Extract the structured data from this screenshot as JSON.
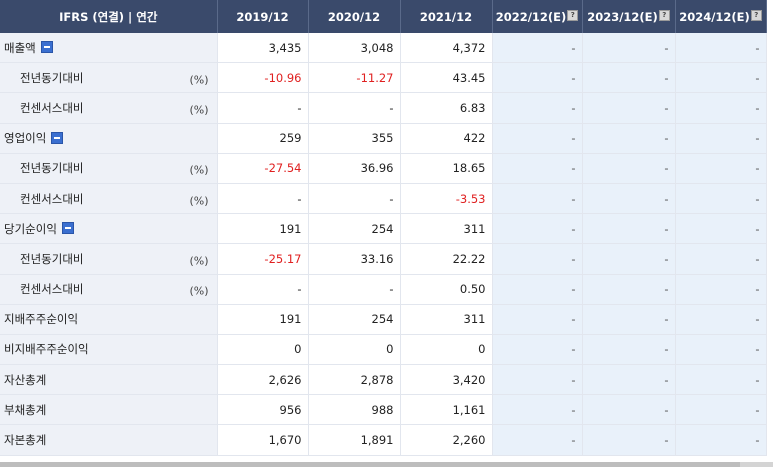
{
  "header": {
    "label": "IFRS (연결) | 연간",
    "columns": [
      {
        "label": "2019/12",
        "estimate": false
      },
      {
        "label": "2020/12",
        "estimate": false
      },
      {
        "label": "2021/12",
        "estimate": false
      },
      {
        "label": "2022/12(E)",
        "estimate": true
      },
      {
        "label": "2023/12(E)",
        "estimate": true
      },
      {
        "label": "2024/12(E)",
        "estimate": true
      }
    ],
    "estimate_icon": "?"
  },
  "rows": [
    {
      "label": "매출액",
      "unit": "",
      "expandable": true,
      "sub": false,
      "values": [
        "3,435",
        "3,048",
        "4,372",
        "-",
        "-",
        "-"
      ]
    },
    {
      "label": "전년동기대비",
      "unit": "(%)",
      "expandable": false,
      "sub": true,
      "values": [
        "-10.96",
        "-11.27",
        "43.45",
        "-",
        "-",
        "-"
      ]
    },
    {
      "label": "컨센서스대비",
      "unit": "(%)",
      "expandable": false,
      "sub": true,
      "values": [
        "-",
        "-",
        "6.83",
        "-",
        "-",
        "-"
      ]
    },
    {
      "label": "영업이익",
      "unit": "",
      "expandable": true,
      "sub": false,
      "values": [
        "259",
        "355",
        "422",
        "-",
        "-",
        "-"
      ]
    },
    {
      "label": "전년동기대비",
      "unit": "(%)",
      "expandable": false,
      "sub": true,
      "values": [
        "-27.54",
        "36.96",
        "18.65",
        "-",
        "-",
        "-"
      ]
    },
    {
      "label": "컨센서스대비",
      "unit": "(%)",
      "expandable": false,
      "sub": true,
      "values": [
        "-",
        "-",
        "-3.53",
        "-",
        "-",
        "-"
      ]
    },
    {
      "label": "당기순이익",
      "unit": "",
      "expandable": true,
      "sub": false,
      "values": [
        "191",
        "254",
        "311",
        "-",
        "-",
        "-"
      ]
    },
    {
      "label": "전년동기대비",
      "unit": "(%)",
      "expandable": false,
      "sub": true,
      "values": [
        "-25.17",
        "33.16",
        "22.22",
        "-",
        "-",
        "-"
      ]
    },
    {
      "label": "컨센서스대비",
      "unit": "(%)",
      "expandable": false,
      "sub": true,
      "values": [
        "-",
        "-",
        "0.50",
        "-",
        "-",
        "-"
      ]
    },
    {
      "label": "지배주주순이익",
      "unit": "",
      "expandable": false,
      "sub": false,
      "values": [
        "191",
        "254",
        "311",
        "-",
        "-",
        "-"
      ]
    },
    {
      "label": "비지배주주순이익",
      "unit": "",
      "expandable": false,
      "sub": false,
      "values": [
        "0",
        "0",
        "0",
        "-",
        "-",
        "-"
      ]
    },
    {
      "label": "자산총계",
      "unit": "",
      "expandable": false,
      "sub": false,
      "values": [
        "2,626",
        "2,878",
        "3,420",
        "-",
        "-",
        "-"
      ]
    },
    {
      "label": "부채총계",
      "unit": "",
      "expandable": false,
      "sub": false,
      "values": [
        "956",
        "988",
        "1,161",
        "-",
        "-",
        "-"
      ]
    },
    {
      "label": "자본총계",
      "unit": "",
      "expandable": false,
      "sub": false,
      "values": [
        "1,670",
        "1,891",
        "2,260",
        "-",
        "-",
        "-"
      ]
    }
  ],
  "colors": {
    "header_bg": "#3a4a6b",
    "negative": "#e02020",
    "estimate_bg": "#e9f1fa",
    "label_bg": "#eef1f7"
  }
}
